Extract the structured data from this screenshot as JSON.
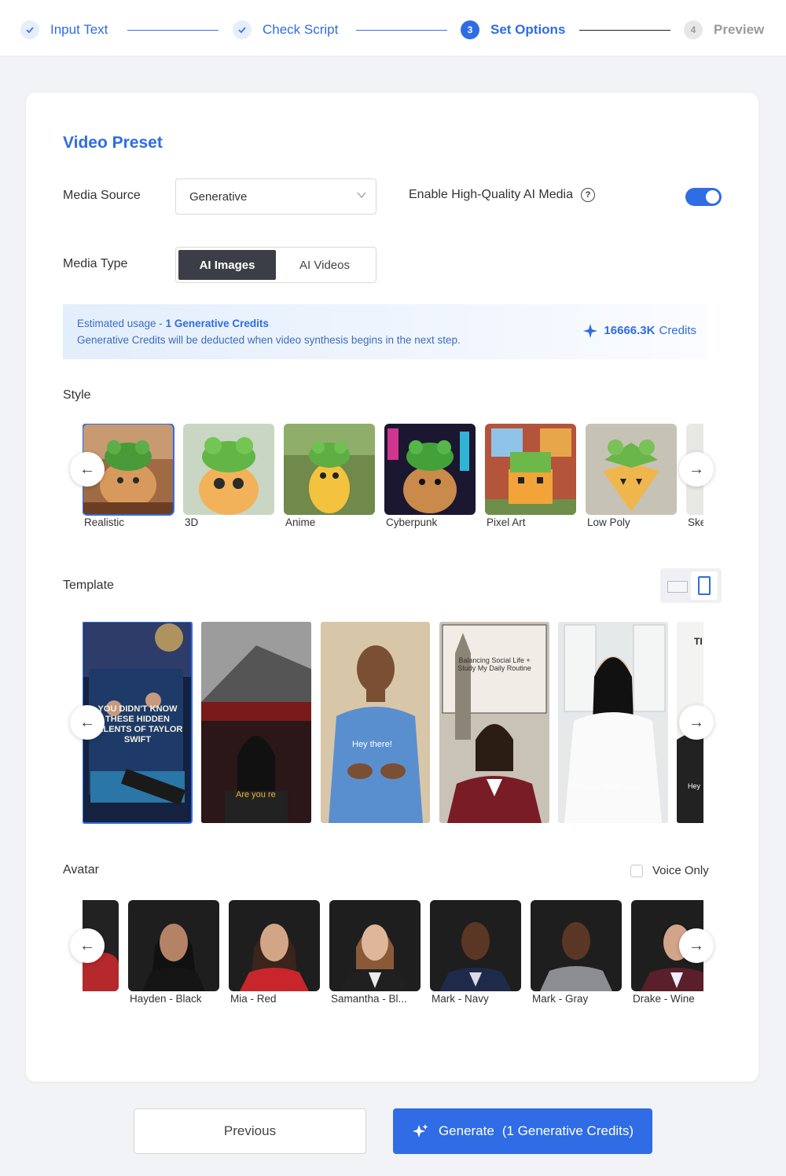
{
  "stepper": {
    "steps": [
      {
        "number": "",
        "label": "Input Text",
        "state": "done"
      },
      {
        "number": "",
        "label": "Check Script",
        "state": "done"
      },
      {
        "number": "3",
        "label": "Set Options",
        "state": "active"
      },
      {
        "number": "4",
        "label": "Preview",
        "state": "todo"
      }
    ]
  },
  "preset": {
    "title": "Video Preset",
    "media_source_label": "Media Source",
    "media_source_value": "Generative",
    "hq_label": "Enable High-Quality AI Media",
    "hq_help": "?",
    "hq_enabled": true,
    "media_type_label": "Media Type",
    "media_type_options": [
      "AI Images",
      "AI Videos"
    ],
    "media_type_selected": "AI Images"
  },
  "notice": {
    "line1_prefix": "Estimated usage - ",
    "line1_bold": "1 Generative Credits",
    "line2": "Generative Credits will be deducted when video synthesis begins in the next step.",
    "credits_value": "16666.3K",
    "credits_unit": "Credits"
  },
  "style": {
    "label": "Style",
    "items": [
      "Realistic",
      "3D",
      "Anime",
      "Cyberpunk",
      "Pixel Art",
      "Low Poly",
      "Sketch"
    ],
    "selected": "Realistic"
  },
  "template": {
    "label": "Template",
    "orientation": "portrait",
    "captions": [
      "YOU DIDN'T KNOW THESE HIDDEN TALENTS OF TAYLOR SWIFT",
      "Are you re",
      "Hey there!",
      "Balancing Social Life + Study My Daily Routine",
      "International delivery",
      "TI",
      "Hey"
    ]
  },
  "avatar": {
    "label": "Avatar",
    "voice_only_label": "Voice Only",
    "voice_only_checked": false,
    "items": [
      "",
      "Hayden - Black",
      "Mia - Red",
      "Samantha - Bl...",
      "Mark - Navy",
      "Mark - Gray",
      "Drake - Wine"
    ]
  },
  "footer": {
    "previous": "Previous",
    "generate_label": "Generate",
    "generate_credits": "(1 Generative Credits)"
  },
  "colors": {
    "accent": "#2f6ce5",
    "dark_segment": "#3b3e46"
  }
}
